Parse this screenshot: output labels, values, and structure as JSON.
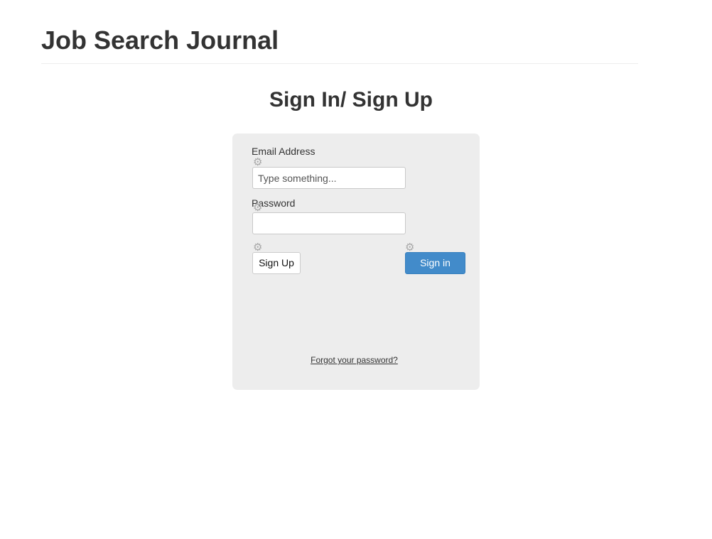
{
  "header": {
    "app_title": "Job Search Journal"
  },
  "page": {
    "heading": "Sign In/ Sign Up"
  },
  "form": {
    "email": {
      "label": "Email Address",
      "placeholder": "Type something...",
      "value": ""
    },
    "password": {
      "label": "Password",
      "value": ""
    },
    "signup_label": "Sign Up",
    "signin_label": "Sign in",
    "forgot_label": "Forgot your password?",
    "gear_icon": "gear-icon"
  },
  "colors": {
    "panel_background": "#ededed",
    "primary_button": "#428bca",
    "gear_icon": "#a8a8a8"
  }
}
